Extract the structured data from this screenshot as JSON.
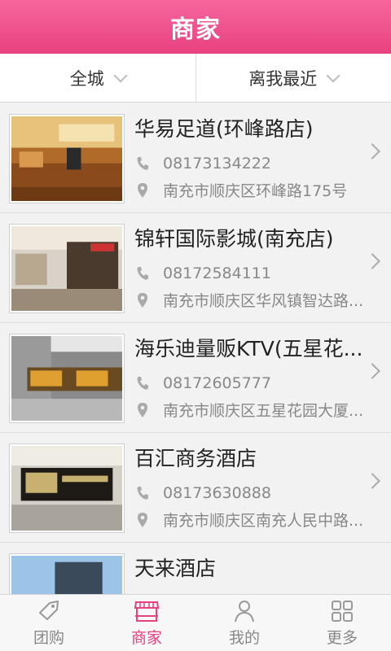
{
  "header": {
    "title": "商家"
  },
  "filters": {
    "area": "全城",
    "sort": "离我最近"
  },
  "merchants": [
    {
      "name": "华易足道(环峰路店)",
      "phone": "08173134222",
      "address": "南充市顺庆区环峰路175号"
    },
    {
      "name": "锦轩国际影城(南充店)",
      "phone": "08172584111",
      "address": "南充市顺庆区华风镇智达路..."
    },
    {
      "name": "海乐迪量贩KTV(五星花...",
      "phone": "08172605777",
      "address": "南充市顺庆区五星花园大厦..."
    },
    {
      "name": "百汇商务酒店",
      "phone": "08173630888",
      "address": "南充市顺庆区南充人民中路..."
    },
    {
      "name": "天来酒店",
      "phone": "",
      "address": ""
    }
  ],
  "tabs": [
    {
      "label": "团购",
      "icon": "tag-icon"
    },
    {
      "label": "商家",
      "icon": "store-icon"
    },
    {
      "label": "我的",
      "icon": "user-icon"
    },
    {
      "label": "更多",
      "icon": "grid-icon"
    }
  ],
  "colors": {
    "accent": "#e8417f"
  }
}
